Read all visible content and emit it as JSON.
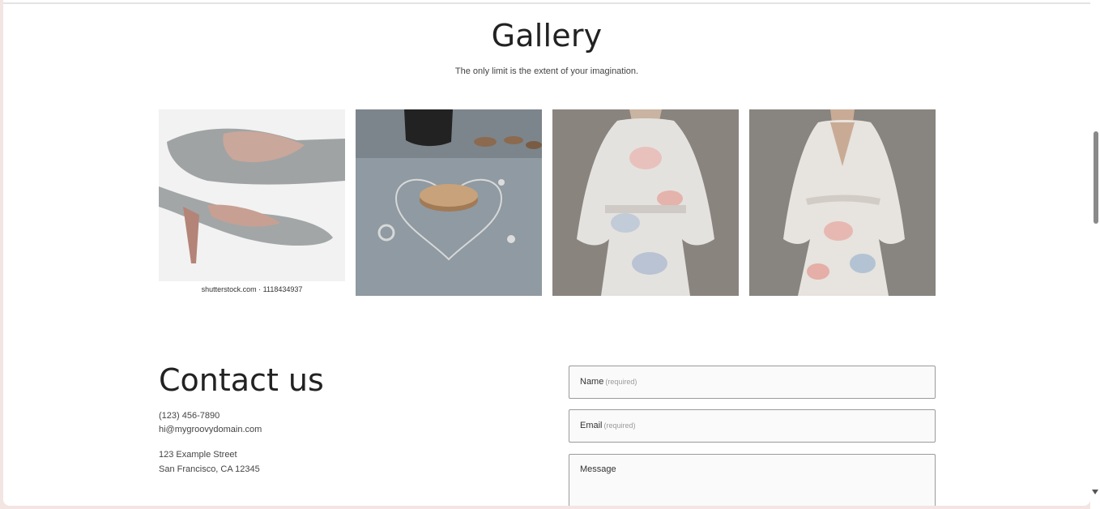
{
  "gallery": {
    "title": "Gallery",
    "subtitle": "The only limit is the extent of your imagination.",
    "images": [
      {
        "name": "gray-heels-photo",
        "caption": "shutterstock.com · 1118434937"
      },
      {
        "name": "silver-necklace-photo",
        "caption": ""
      },
      {
        "name": "floral-dress-photo-1",
        "caption": ""
      },
      {
        "name": "floral-dress-photo-2",
        "caption": ""
      }
    ]
  },
  "contact": {
    "title": "Contact us",
    "phone": "(123) 456-7890",
    "email": "hi@mygroovydomain.com",
    "street": "123 Example Street",
    "city": "San Francisco, CA 12345"
  },
  "form": {
    "name_label": "Name",
    "name_required": "(required)",
    "email_label": "Email",
    "email_required": "(required)",
    "message_label": "Message"
  },
  "colors": {
    "page_bg": "#ffffff",
    "frame_bg": "#f3e6e2",
    "field_border": "#9b9b9b",
    "field_bg": "#fafafa"
  }
}
